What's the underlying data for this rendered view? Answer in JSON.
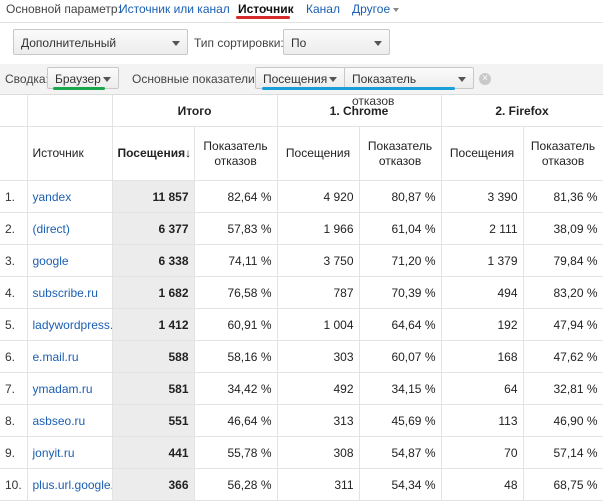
{
  "top": {
    "label": "Основной параметр:",
    "links": [
      "Источник или канал",
      "Источник",
      "Канал",
      "Другое"
    ]
  },
  "toolbar": {
    "secondary_dim": "Дополнительный параметр",
    "sort_label": "Тип сортировки:",
    "sort_value": "По умолчанию"
  },
  "pivot": {
    "summary_label": "Сводка:",
    "summary_value": "Браузер",
    "metrics_label": "Основные показатели:",
    "metric1": "Посещения",
    "metric2": "Показатель отказов",
    "remove": "×"
  },
  "colors": {
    "link": "#1a5fb4",
    "green_underline": "#1aa64b",
    "red_underline": "#d62b2b",
    "blue_underline": "#1b9fd9"
  },
  "table": {
    "groups": [
      "Итого",
      "1. Chrome",
      "2. Firefox"
    ],
    "dim_header": "Источник",
    "col_visits": "Посещения",
    "col_visits_sort": "Посещения",
    "sort_marker": "↓",
    "col_bounce": "Показатель отказов",
    "rows": [
      {
        "n": "1.",
        "source": "yandex",
        "tv": "11 857",
        "tb": "82,64 %",
        "cv": "4 920",
        "cb": "80,87 %",
        "fv": "3 390",
        "fb": "81,36 %"
      },
      {
        "n": "2.",
        "source": "(direct)",
        "tv": "6 377",
        "tb": "57,83 %",
        "cv": "1 966",
        "cb": "61,04 %",
        "fv": "2 111",
        "fb": "38,09 %"
      },
      {
        "n": "3.",
        "source": "google",
        "tv": "6 338",
        "tb": "74,11 %",
        "cv": "3 750",
        "cb": "71,20 %",
        "fv": "1 379",
        "fb": "79,84 %"
      },
      {
        "n": "4.",
        "source": "subscribe.ru",
        "tv": "1 682",
        "tb": "76,58 %",
        "cv": "787",
        "cb": "70,39 %",
        "fv": "494",
        "fb": "83,20 %"
      },
      {
        "n": "5.",
        "source": "ladywordpress.ru",
        "tv": "1 412",
        "tb": "60,91 %",
        "cv": "1 004",
        "cb": "64,64 %",
        "fv": "192",
        "fb": "47,94 %"
      },
      {
        "n": "6.",
        "source": "e.mail.ru",
        "tv": "588",
        "tb": "58,16 %",
        "cv": "303",
        "cb": "60,07 %",
        "fv": "168",
        "fb": "47,62 %"
      },
      {
        "n": "7.",
        "source": "ymadam.ru",
        "tv": "581",
        "tb": "34,42 %",
        "cv": "492",
        "cb": "34,15 %",
        "fv": "64",
        "fb": "32,81 %"
      },
      {
        "n": "8.",
        "source": "asbseo.ru",
        "tv": "551",
        "tb": "46,64 %",
        "cv": "313",
        "cb": "45,69 %",
        "fv": "113",
        "fb": "46,90 %"
      },
      {
        "n": "9.",
        "source": "jonyit.ru",
        "tv": "441",
        "tb": "55,78 %",
        "cv": "308",
        "cb": "54,87 %",
        "fv": "70",
        "fb": "57,14 %"
      },
      {
        "n": "10.",
        "source": "plus.url.google.com",
        "tv": "366",
        "tb": "56,28 %",
        "cv": "311",
        "cb": "54,34 %",
        "fv": "48",
        "fb": "68,75 %"
      }
    ]
  }
}
